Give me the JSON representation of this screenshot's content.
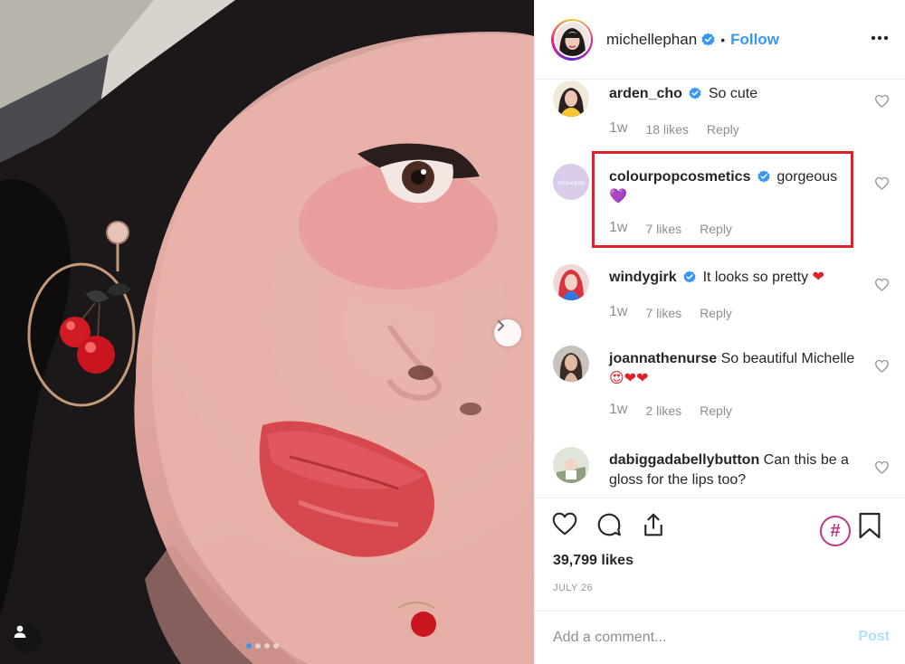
{
  "post": {
    "author": {
      "username": "michellephan",
      "verified": true,
      "follow_label": "Follow",
      "separator": "•",
      "more_icon": "ellipsis-icon"
    },
    "carousel": {
      "next_icon": "chevron-right-icon",
      "total_slides": 4,
      "active_slide": 1,
      "tag_icon": "user-tag-icon"
    },
    "comments": [
      {
        "username": "arden_cho",
        "verified": true,
        "text": "So cute",
        "time": "1w",
        "likes": "18 likes",
        "reply": "Reply"
      },
      {
        "username": "colourpopcosmetics",
        "verified": true,
        "text": "gorgeous",
        "emoji": "💜",
        "time": "1w",
        "likes": "7 likes",
        "reply": "Reply",
        "highlighted": true,
        "avatar_text": "colourpop"
      },
      {
        "username": "windygirk",
        "verified": true,
        "text": "It looks so pretty",
        "emoji": "❤",
        "time": "1w",
        "likes": "7 likes",
        "reply": "Reply"
      },
      {
        "username": "joannathenurse",
        "verified": false,
        "text": "So beautiful Michelle",
        "emoji": "😍❤❤",
        "time": "1w",
        "likes": "2 likes",
        "reply": "Reply"
      },
      {
        "username": "dabiggadabellybutton",
        "verified": false,
        "text": "Can this be a gloss for the lips too?"
      }
    ],
    "likes_count": "39,799 likes",
    "date": "JULY 26",
    "add_comment": {
      "placeholder": "Add a comment...",
      "post_label": "Post"
    },
    "hashtag_badge": "#"
  },
  "colors": {
    "accent": "#3897f0",
    "highlight": "#e0212b",
    "muted": "#8e8e8e",
    "post_disabled": "#b2dffc"
  }
}
